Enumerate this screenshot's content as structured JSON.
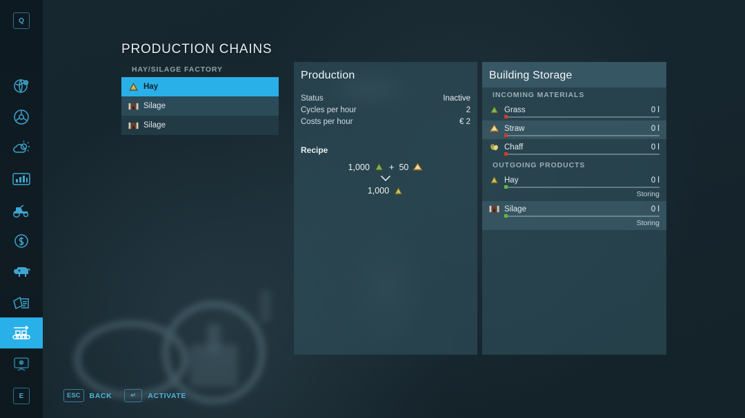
{
  "page": {
    "title": "PRODUCTION CHAINS"
  },
  "sidebar": {
    "top_key": "Q",
    "bottom_key": "E",
    "items": [
      {
        "icon": "globe-map-icon",
        "active": false
      },
      {
        "icon": "steering-wheel-icon",
        "active": false
      },
      {
        "icon": "weather-cloud-sun-icon",
        "active": false
      },
      {
        "icon": "statistics-chart-icon",
        "active": false
      },
      {
        "icon": "tractor-vehicles-icon",
        "active": false
      },
      {
        "icon": "finances-dollar-icon",
        "active": false
      },
      {
        "icon": "animals-cow-icon",
        "active": false
      },
      {
        "icon": "contracts-papers-icon",
        "active": false
      },
      {
        "icon": "production-conveyor-icon",
        "active": true
      },
      {
        "icon": "multiplayer-screen-icon",
        "active": false
      }
    ]
  },
  "production_list": {
    "header": "HAY/SILAGE FACTORY",
    "rows": [
      {
        "label": "Hay",
        "icon": "hay-icon",
        "state": "selected"
      },
      {
        "label": "Silage",
        "icon": "silage-icon",
        "state": "alt"
      },
      {
        "label": "Silage",
        "icon": "silage-icon",
        "state": "plain"
      }
    ]
  },
  "production_panel": {
    "title": "Production",
    "stats": [
      {
        "label": "Status",
        "value": "Inactive"
      },
      {
        "label": "Cycles per hour",
        "value": "2"
      },
      {
        "label": "Costs per hour",
        "value": "€ 2"
      }
    ],
    "recipe": {
      "title": "Recipe",
      "inputs": [
        {
          "amount": "1,000",
          "icon": "grass-icon"
        },
        {
          "amount": "50",
          "icon": "straw-icon"
        }
      ],
      "plus": "+",
      "outputs": [
        {
          "amount": "1,000",
          "icon": "hay-icon"
        }
      ]
    }
  },
  "storage_panel": {
    "title": "Building Storage",
    "sections": [
      {
        "header": "INCOMING MATERIALS",
        "rows": [
          {
            "label": "Grass",
            "icon": "grass-icon",
            "amount": "0 l",
            "dot": "red",
            "fill": 0,
            "shade": false,
            "note": null
          },
          {
            "label": "Straw",
            "icon": "straw-icon",
            "amount": "0 l",
            "dot": "red",
            "fill": 0,
            "shade": true,
            "note": null
          },
          {
            "label": "Chaff",
            "icon": "chaff-icon",
            "amount": "0 l",
            "dot": "red",
            "fill": 0,
            "shade": false,
            "note": null
          }
        ]
      },
      {
        "header": "OUTGOING PRODUCTS",
        "rows": [
          {
            "label": "Hay",
            "icon": "hay-icon",
            "amount": "0 l",
            "dot": "green",
            "fill": 0,
            "shade": false,
            "note": "Storing"
          },
          {
            "label": "Silage",
            "icon": "silage-icon",
            "amount": "0 l",
            "dot": "green",
            "fill": 0,
            "shade": true,
            "note": "Storing"
          }
        ]
      }
    ]
  },
  "helpbar": {
    "items": [
      {
        "key": "ESC",
        "label": "BACK",
        "icon": "esc-key-icon"
      },
      {
        "key": "↵",
        "label": "ACTIVATE",
        "icon": "enter-key-icon"
      }
    ]
  },
  "colors": {
    "accent": "#2ab0e8",
    "icon_blue": "#3ea5d0",
    "panel_bg": "#2e4d58",
    "page_bg": "#16262e",
    "status_red": "#cf3a32",
    "status_green": "#5fba3c"
  }
}
